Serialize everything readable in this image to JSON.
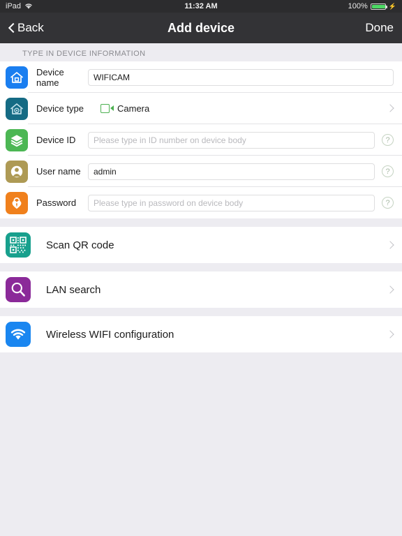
{
  "statusbar": {
    "device_label": "iPad",
    "wifi_icon": "wifi-icon",
    "time": "11:32 AM",
    "battery_percent": "100%",
    "battery_icon": "battery-charging-icon"
  },
  "navbar": {
    "back_label": "Back",
    "back_icon": "chevron-left-icon",
    "title": "Add device",
    "done_label": "Done"
  },
  "form_section": {
    "header": "TYPE IN DEVICE INFORMATION",
    "rows": [
      {
        "label": "Device name",
        "icon": "home-icon",
        "icon_color": "#1a7ef0",
        "value": "WIFICAM",
        "placeholder": "",
        "has_help": false,
        "has_chevron": false
      },
      {
        "label": "Device type",
        "icon": "home-camera-icon",
        "icon_color": "#156b84",
        "value": "Camera",
        "value_icon": "video-camera-icon",
        "value_icon_color": "#4cb050",
        "has_help": false,
        "has_chevron": true
      },
      {
        "label": "Device ID",
        "icon": "layers-icon",
        "icon_color": "#4cb754",
        "value": "",
        "placeholder": "Please type in ID number on device body",
        "has_help": true,
        "has_chevron": false
      },
      {
        "label": "User name",
        "icon": "user-icon",
        "icon_color": "#ae9a55",
        "value": "admin",
        "placeholder": "",
        "has_help": true,
        "has_chevron": false
      },
      {
        "label": "Password",
        "icon": "lock-icon",
        "icon_color": "#f0801c",
        "value": "",
        "placeholder": "Please type in password on device body",
        "has_help": true,
        "has_chevron": false
      }
    ],
    "help_glyph": "?"
  },
  "action_sections": [
    {
      "title": "Scan QR code",
      "icon": "qr-code-icon",
      "icon_color": "#18a08d"
    },
    {
      "title": "LAN search",
      "icon": "search-icon",
      "icon_color": "#8b2a99"
    },
    {
      "title": "Wireless WIFI configuration",
      "icon": "wifi-signal-icon",
      "icon_color": "#1a86f0"
    }
  ],
  "colors": {
    "navbar": "#333336",
    "statusbar": "#2c2c2e",
    "page_background": "#edecf1",
    "row_background": "#ffffff",
    "separator": "#e3e3e6",
    "placeholder_text": "#b9b9bd",
    "battery_green": "#4cd964"
  }
}
